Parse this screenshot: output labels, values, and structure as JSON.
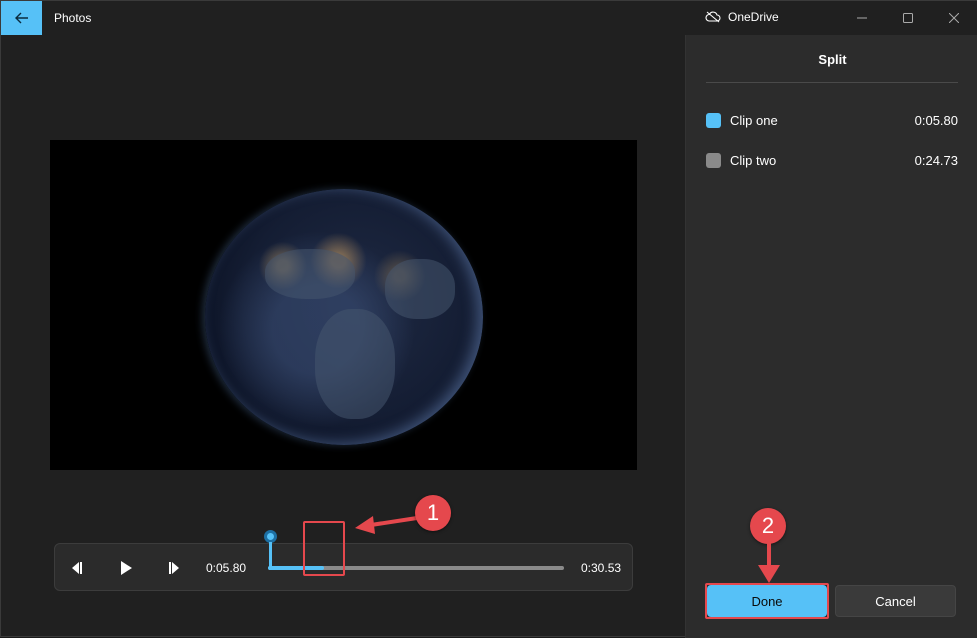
{
  "app": {
    "title": "Photos",
    "onedrive_label": "OneDrive"
  },
  "player": {
    "current_time": "0:05.80",
    "total_time": "0:30.53",
    "progress_fraction": 0.19
  },
  "split_panel": {
    "title": "Split",
    "clips": [
      {
        "name": "Clip one",
        "duration": "0:05.80",
        "color": "#56c1f7"
      },
      {
        "name": "Clip two",
        "duration": "0:24.73",
        "color": "#8a8a8a"
      }
    ],
    "done_label": "Done",
    "cancel_label": "Cancel"
  },
  "annotations": {
    "step1": "1",
    "step2": "2"
  },
  "colors": {
    "accent": "#56c1f7",
    "annotation": "#e5484d"
  }
}
